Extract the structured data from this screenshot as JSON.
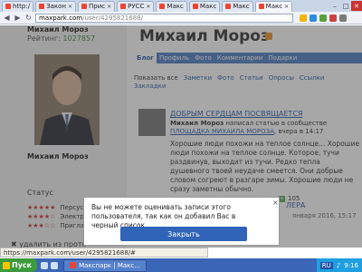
{
  "browser": {
    "tabs": [
      {
        "label": "http:/"
      },
      {
        "label": "Закон"
      },
      {
        "label": "Прис"
      },
      {
        "label": "РУСС"
      },
      {
        "label": "Макс"
      },
      {
        "label": "Макс"
      },
      {
        "label": "Макс"
      },
      {
        "label": "Макс"
      }
    ],
    "url_host": "maxpark.com",
    "url_path": "/user/4295821688/"
  },
  "sidebar": {
    "name": "Михаил Мороз",
    "rating_label": "Рейтинг:",
    "rating_value": "1027857",
    "sub_name": "Михаил Мороз",
    "sub_status": "Статус",
    "status_heading": "Статус",
    "status_rows": [
      {
        "stars": "★★★★★",
        "label": "Персус"
      },
      {
        "stars": "★★★★☆",
        "label": "Электро"
      },
      {
        "stars": "★★★☆☆",
        "label": "Пригла"
      }
    ],
    "bottom_link": "✖ удалить из проти"
  },
  "main": {
    "title": "Михаил Мороз",
    "tabs": [
      "Блог",
      "Профиль",
      "Фото",
      "Комментарии",
      "Подарки"
    ],
    "subnav": [
      "Показать все",
      "Заметки",
      "Фото",
      "Статьи",
      "Опросы",
      "Ссылки"
    ],
    "subnav_extra": "Закладки",
    "post_title": "ДОБРЫМ СЕРДЦАМ ПОСВЯЩАЕТСЯ",
    "post_author": "Михаил Мороз",
    "post_meta_text": "написал статью в сообществе",
    "post_community": "ПЛОЩАДКА МИХАИЛА МОРОЗА",
    "post_time": "вчера в 14:17",
    "post_body": "Хорошие люди похожи на теплое солнце... Хорошие люди похожи на теплое солнце. Которое, тучи раздвинув, выходит из тучи. Редко тепла душевного твоей неудаче смеется. Они добрые словом согреют в разгаре зимы. Хорошие люди не сразу заметны обычно.",
    "counter_value": "105",
    "second_post_title": "ЛЕРА",
    "second_post_date": "января 2016, 15:17"
  },
  "modal": {
    "message": "Вы не можете оценивать записи этого пользователя, так как он добавил Вас в черный список",
    "close_label": "×",
    "button_label": "Закрыть"
  },
  "statusbar": {
    "url": "https://maxpark.com/user/4295821688/#"
  },
  "taskbar": {
    "start_label": "Пуск",
    "task_label": "Макспарк | Макс...",
    "lang": "RU",
    "time": "9:16"
  },
  "colors": {
    "accent": "#2f64b8",
    "tab_blue": "#4d7fc4",
    "rating_green": "#3a8a3a"
  }
}
